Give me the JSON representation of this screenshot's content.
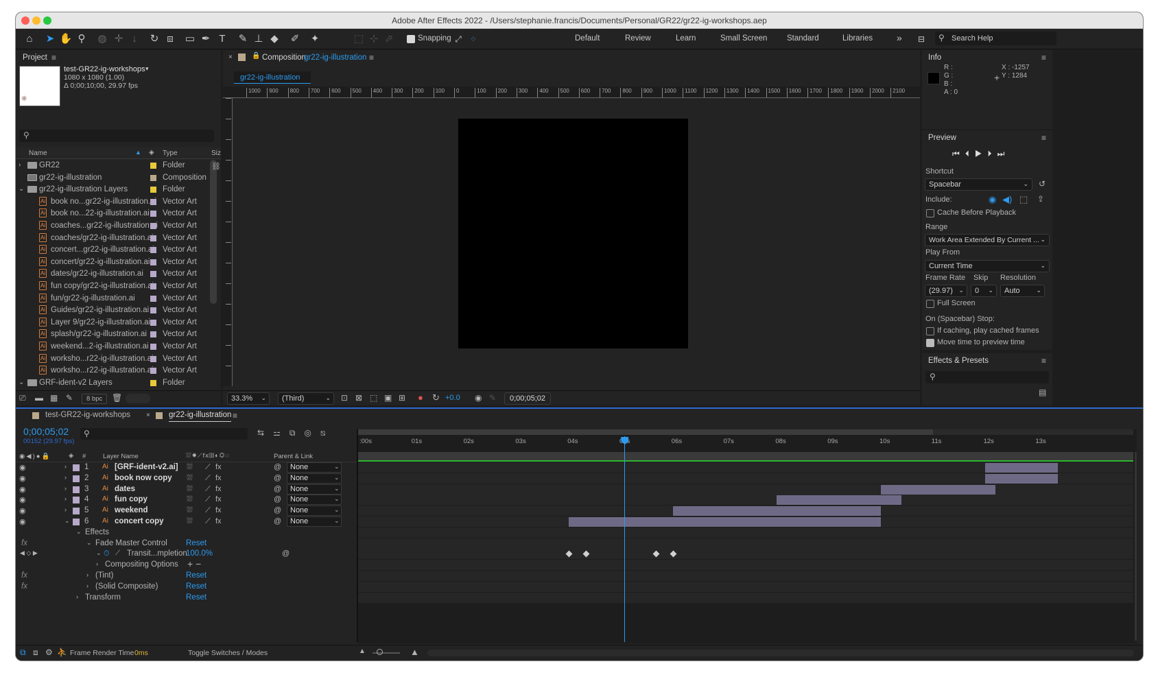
{
  "window": {
    "title": "Adobe After Effects 2022 - /Users/stephanie.francis/Documents/Personal/GR22/gr22-ig-workshops.aep"
  },
  "toolbar": {
    "snapping": "Snapping",
    "workspaces": [
      "Default",
      "Review",
      "Learn",
      "Small Screen",
      "Standard",
      "Libraries"
    ],
    "search_placeholder": "Search Help"
  },
  "project": {
    "title": "Project",
    "item_name": "test-GR22-ig-workshops",
    "item_info1": "1080 x 1080 (1.00)",
    "item_info2": "Δ 0;00;10;00, 29.97 fps",
    "col_name": "Name",
    "col_type": "Type",
    "col_size": "Siz",
    "rows": [
      {
        "name": "GR22",
        "type": "Folder",
        "kind": "folder",
        "color": "#e6c93a",
        "indent": 1,
        "arrow": "›"
      },
      {
        "name": "gr22-ig-illustration",
        "type": "Composition",
        "kind": "comp",
        "color": "#b9a88c",
        "indent": 1,
        "arrow": ""
      },
      {
        "name": "gr22-ig-illustration Layers",
        "type": "Folder",
        "kind": "folder",
        "color": "#e6c93a",
        "indent": 1,
        "arrow": "⌄"
      },
      {
        "name": "book no...gr22-ig-illustration.ai",
        "type": "Vector Art",
        "kind": "ai",
        "color": "#b7a9c9",
        "indent": 2,
        "arrow": ""
      },
      {
        "name": "book no...22-ig-illustration.ai",
        "type": "Vector Art",
        "kind": "ai",
        "color": "#b7a9c9",
        "indent": 2,
        "arrow": ""
      },
      {
        "name": "coaches...gr22-ig-illustration.ai",
        "type": "Vector Art",
        "kind": "ai",
        "color": "#b7a9c9",
        "indent": 2,
        "arrow": ""
      },
      {
        "name": "coaches/gr22-ig-illustration.ai",
        "type": "Vector Art",
        "kind": "ai",
        "color": "#b7a9c9",
        "indent": 2,
        "arrow": ""
      },
      {
        "name": "concert...gr22-ig-illustration.ai",
        "type": "Vector Art",
        "kind": "ai",
        "color": "#b7a9c9",
        "indent": 2,
        "arrow": ""
      },
      {
        "name": "concert/gr22-ig-illustration.ai",
        "type": "Vector Art",
        "kind": "ai",
        "color": "#b7a9c9",
        "indent": 2,
        "arrow": ""
      },
      {
        "name": "dates/gr22-ig-illustration.ai",
        "type": "Vector Art",
        "kind": "ai",
        "color": "#b7a9c9",
        "indent": 2,
        "arrow": ""
      },
      {
        "name": "fun copy/gr22-ig-illustration.ai",
        "type": "Vector Art",
        "kind": "ai",
        "color": "#b7a9c9",
        "indent": 2,
        "arrow": ""
      },
      {
        "name": "fun/gr22-ig-illustration.ai",
        "type": "Vector Art",
        "kind": "ai",
        "color": "#b7a9c9",
        "indent": 2,
        "arrow": ""
      },
      {
        "name": "Guides/gr22-ig-illustration.ai",
        "type": "Vector Art",
        "kind": "ai",
        "color": "#b7a9c9",
        "indent": 2,
        "arrow": ""
      },
      {
        "name": "Layer 9/gr22-ig-illustration.ai",
        "type": "Vector Art",
        "kind": "ai",
        "color": "#b7a9c9",
        "indent": 2,
        "arrow": ""
      },
      {
        "name": "splash/gr22-ig-illustration.ai",
        "type": "Vector Art",
        "kind": "ai",
        "color": "#b7a9c9",
        "indent": 2,
        "arrow": ""
      },
      {
        "name": "weekend...2-ig-illustration.ai",
        "type": "Vector Art",
        "kind": "ai",
        "color": "#b7a9c9",
        "indent": 2,
        "arrow": ""
      },
      {
        "name": "worksho...r22-ig-illustration.ai",
        "type": "Vector Art",
        "kind": "ai",
        "color": "#b7a9c9",
        "indent": 2,
        "arrow": ""
      },
      {
        "name": "worksho...r22-ig-illustration.ai",
        "type": "Vector Art",
        "kind": "ai",
        "color": "#b7a9c9",
        "indent": 2,
        "arrow": ""
      },
      {
        "name": "GRF-ident-v2 Layers",
        "type": "Folder",
        "kind": "folder",
        "color": "#e6c93a",
        "indent": 1,
        "arrow": "⌄"
      }
    ],
    "bpc": "8 bpc"
  },
  "composition": {
    "panel_label": "Composition",
    "comp_name": "gr22-ig-illustration",
    "tab": "gr22-ig-illustration",
    "ruler_labels": [
      "1000",
      "900",
      "800",
      "700",
      "600",
      "500",
      "400",
      "300",
      "200",
      "100",
      "0",
      "100",
      "200",
      "300",
      "400",
      "500",
      "600",
      "700",
      "800",
      "900",
      "1000",
      "1100",
      "1200",
      "1300",
      "1400",
      "1500",
      "1600",
      "1700",
      "1800",
      "1900",
      "2000",
      "2100"
    ],
    "zoom": "33.3%",
    "resolution": "(Third)",
    "exposure": "+0.0",
    "timecode": "0;00;05;02"
  },
  "info": {
    "title": "Info",
    "r": "R :",
    "g": "G :",
    "b": "B :",
    "a": "A :  0",
    "x": "X : -1257",
    "y": "Y : 1284"
  },
  "preview": {
    "title": "Preview",
    "shortcut_label": "Shortcut",
    "shortcut": "Spacebar",
    "include_label": "Include:",
    "cache": "Cache Before Playback",
    "range_label": "Range",
    "range": "Work Area Extended By Current ...",
    "play_from_label": "Play From",
    "play_from": "Current Time",
    "frame_rate_label": "Frame Rate",
    "skip_label": "Skip",
    "resolution_label": "Resolution",
    "frame_rate": "(29.97)",
    "skip": "0",
    "resolution": "Auto",
    "full_screen": "Full Screen",
    "stop_label": "On (Spacebar) Stop:",
    "if_caching": "If caching, play cached frames",
    "move_time": "Move time to preview time"
  },
  "effects": {
    "title": "Effects & Presets"
  },
  "timeline": {
    "tabs": [
      "test-GR22-ig-workshops",
      "gr22-ig-illustration"
    ],
    "timecode": "0;00;05;02",
    "frames": "00152 (29.97 fps)",
    "col_layer": "Layer Name",
    "col_parent": "Parent & Link",
    "col_num": "#",
    "ruler": [
      ":00s",
      "01s",
      "02s",
      "03s",
      "04s",
      "05s",
      "06s",
      "07s",
      "08s",
      "09s",
      "10s",
      "11s",
      "12s",
      "13s"
    ],
    "layers": [
      {
        "num": "1",
        "name": "[GRF-ident-v2.ai]",
        "parent": "None",
        "color": "#b7a9c9",
        "start": 12.0,
        "end": 13.4
      },
      {
        "num": "2",
        "name": "book now copy",
        "parent": "None",
        "color": "#b7a9c9",
        "start": 12.0,
        "end": 13.4
      },
      {
        "num": "3",
        "name": "dates",
        "parent": "None",
        "color": "#b7a9c9",
        "start": 10.0,
        "end": 12.2
      },
      {
        "num": "4",
        "name": "fun copy",
        "parent": "None",
        "color": "#b7a9c9",
        "start": 8.0,
        "end": 10.4
      },
      {
        "num": "5",
        "name": "weekend",
        "parent": "None",
        "color": "#b7a9c9",
        "start": 6.0,
        "end": 10.0
      },
      {
        "num": "6",
        "name": "concert copy",
        "parent": "None",
        "color": "#b7a9c9",
        "start": 4.0,
        "end": 10.0
      }
    ],
    "sub": [
      {
        "label": "Effects",
        "level": 1
      },
      {
        "label": "Fade Master Control",
        "level": 2,
        "reset": "Reset"
      },
      {
        "label": "Transit...mpletion",
        "level": 3,
        "value": "100.0%"
      },
      {
        "label": "Compositing Options",
        "level": 3
      },
      {
        "label": "(Tint)",
        "level": 2,
        "reset": "Reset"
      },
      {
        "label": "(Solid Composite)",
        "level": 2,
        "reset": "Reset"
      },
      {
        "label": "Transform",
        "level": 1,
        "reset": "Reset"
      }
    ],
    "keyframes": [
      4.0,
      4.33,
      5.67,
      6.0
    ],
    "current_time": 5.07,
    "work_area_end": 11.0,
    "frame_render_label": "Frame Render Time",
    "frame_render": "0ms",
    "toggle": "Toggle Switches / Modes"
  }
}
